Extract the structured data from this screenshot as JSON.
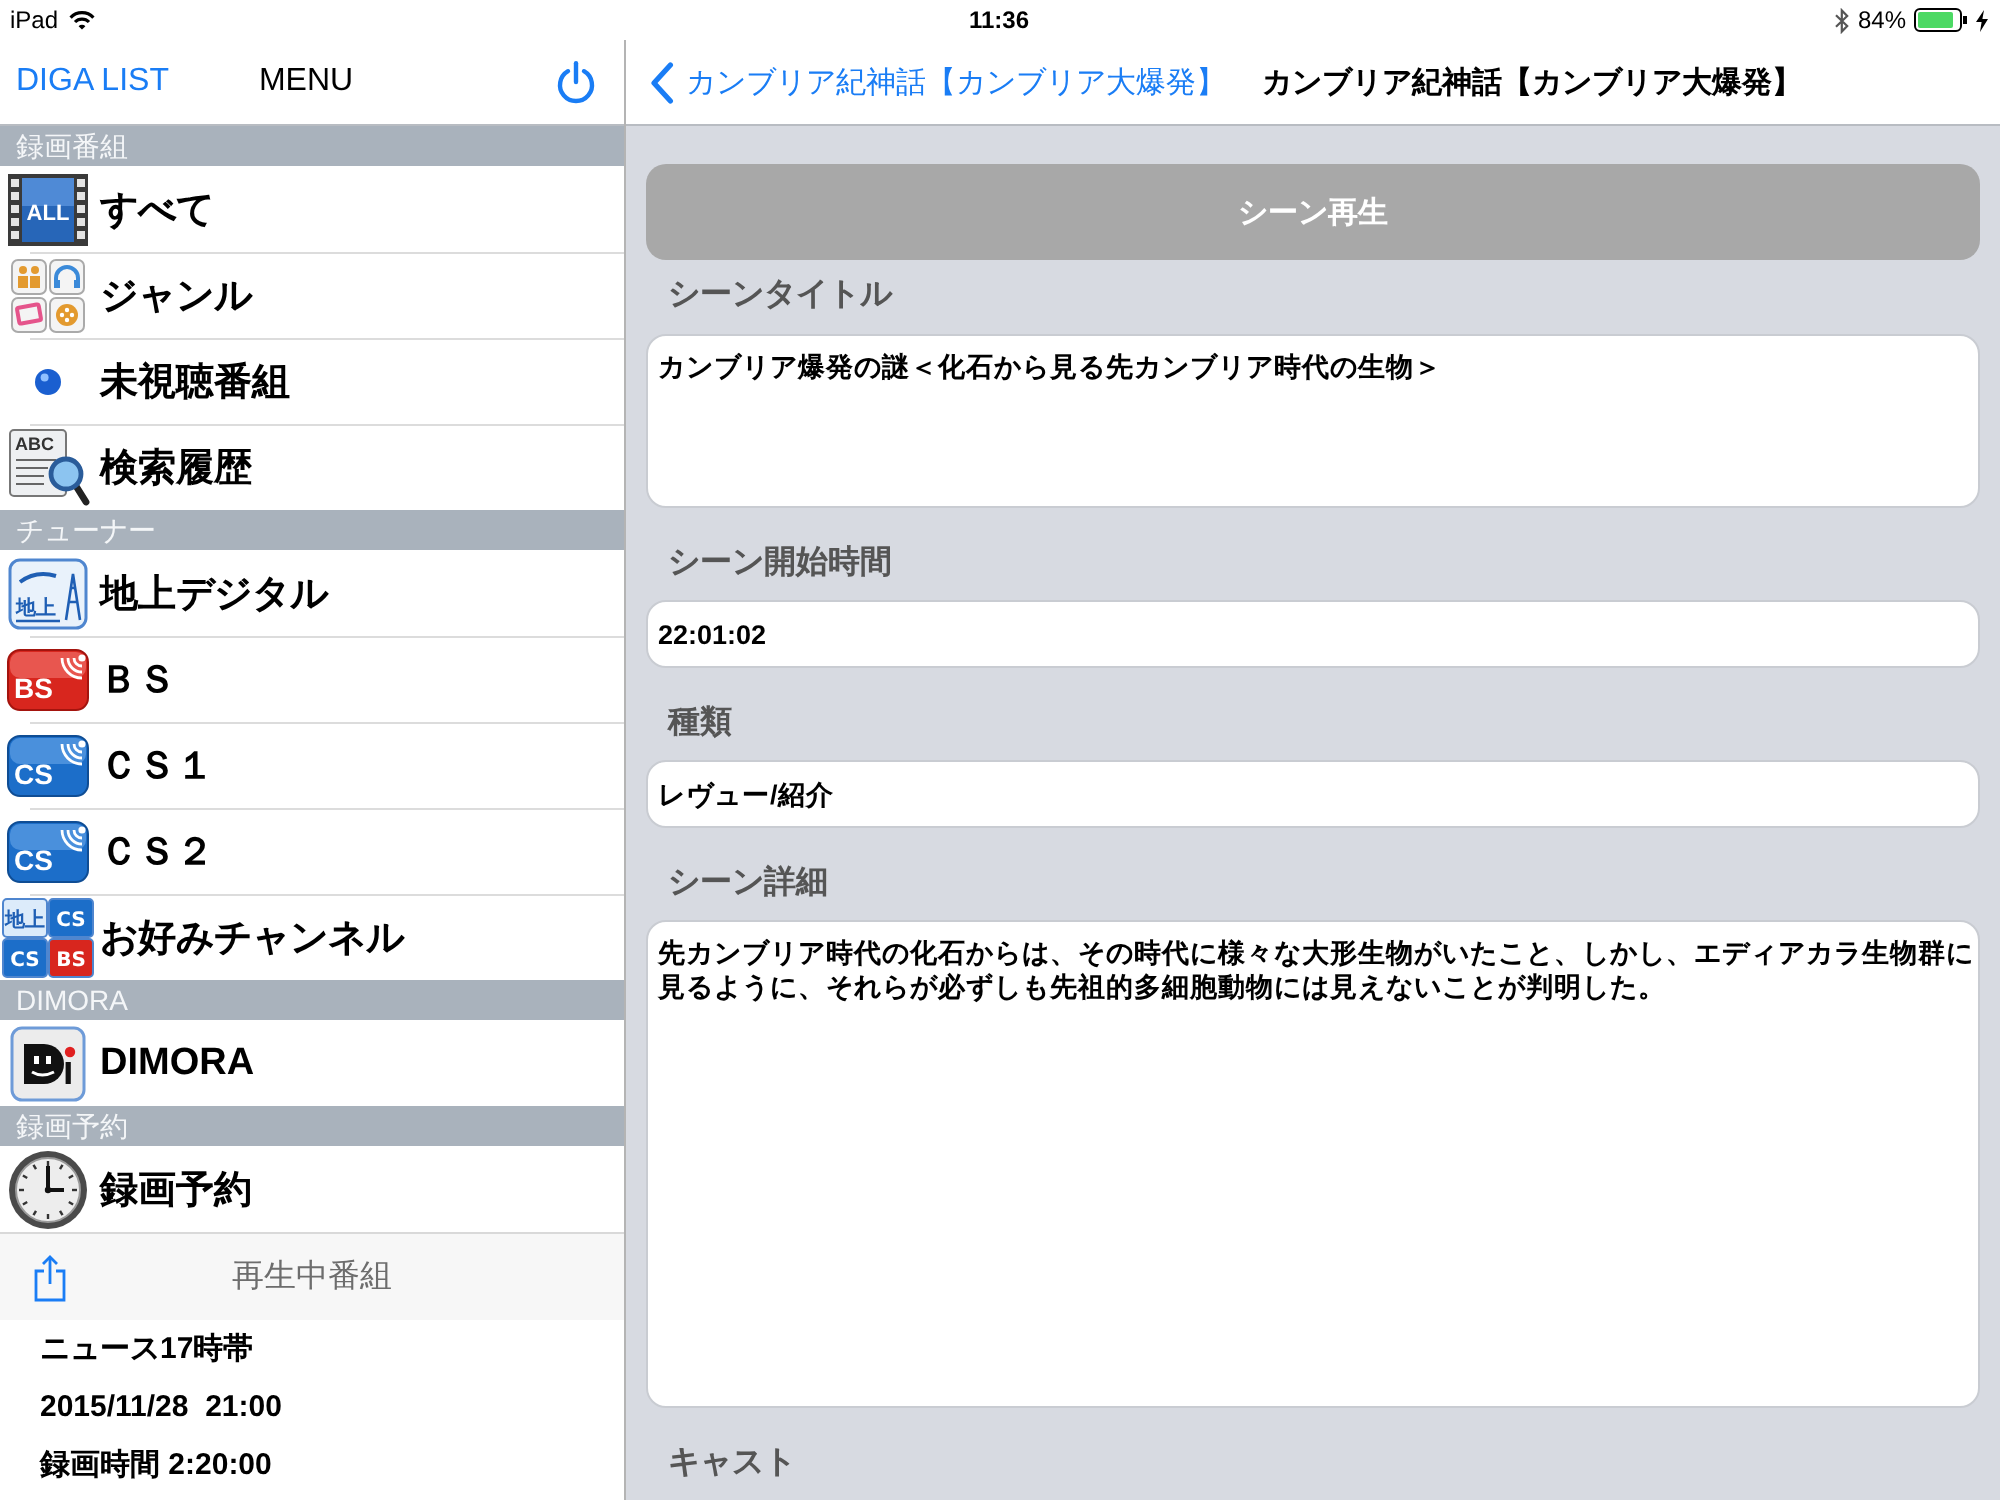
{
  "status_bar": {
    "device": "iPad",
    "time": "11:36",
    "battery": "84%"
  },
  "sidebar": {
    "nav": {
      "back": "DIGA LIST",
      "title": "MENU"
    },
    "sections": [
      {
        "header": "録画番組",
        "items": [
          {
            "label": "すべて",
            "kind": "all",
            "icon_text": [
              "ALL"
            ]
          },
          {
            "label": "ジャンル",
            "kind": "genre"
          },
          {
            "label": "未視聴番組",
            "kind": "unwatched"
          },
          {
            "label": "検索履歴",
            "kind": "search",
            "icon_text": [
              "ABC"
            ]
          }
        ]
      },
      {
        "header": "チューナー",
        "items": [
          {
            "label": "地上デジタル",
            "kind": "terrestrial",
            "icon_text": [
              "地上"
            ]
          },
          {
            "label": "ＢＳ",
            "kind": "bs",
            "icon_text": [
              "BS"
            ]
          },
          {
            "label": "ＣＳ１",
            "kind": "cs",
            "icon_text": [
              "CS"
            ]
          },
          {
            "label": "ＣＳ２",
            "kind": "cs",
            "icon_text": [
              "CS"
            ]
          },
          {
            "label": "お好みチャンネル",
            "kind": "favorite",
            "icon_text": [
              "地上",
              "CS",
              "CS",
              "BS"
            ]
          }
        ]
      },
      {
        "header": "DIMORA",
        "items": [
          {
            "label": "DIMORA",
            "kind": "dimora"
          }
        ]
      },
      {
        "header": "録画予約",
        "items": [
          {
            "label": "録画予約",
            "kind": "clock"
          }
        ]
      }
    ],
    "now_playing": {
      "title": "再生中番組",
      "lines": [
        "ニュース17時帯",
        "2015/11/28  21:00",
        "録画時間 2:20:00"
      ]
    }
  },
  "detail": {
    "nav": {
      "back": "カンブリア紀神話【カンブリア大爆発】",
      "title": "カンブリア紀神話【カンブリア大爆発】"
    },
    "play_button": "シーン再生",
    "fields": [
      {
        "label": "シーンタイトル",
        "kind": "area",
        "value": "カンブリア爆発の謎＜化石から見る先カンブリア時代の生物＞"
      },
      {
        "label": "シーン開始時間",
        "kind": "line",
        "value": "22:01:02"
      },
      {
        "label": "種類",
        "kind": "line",
        "value": "レヴュー/紹介"
      },
      {
        "label": "シーン詳細",
        "kind": "page",
        "value": "先カンブリア時代の化石からは、その時代に様々な大形生物がいたこと、しかし、エディアカラ生物群に見るように、それらが必ずしも先祖的多細胞動物には見えないことが判明した。"
      },
      {
        "label": "キャスト"
      }
    ]
  }
}
